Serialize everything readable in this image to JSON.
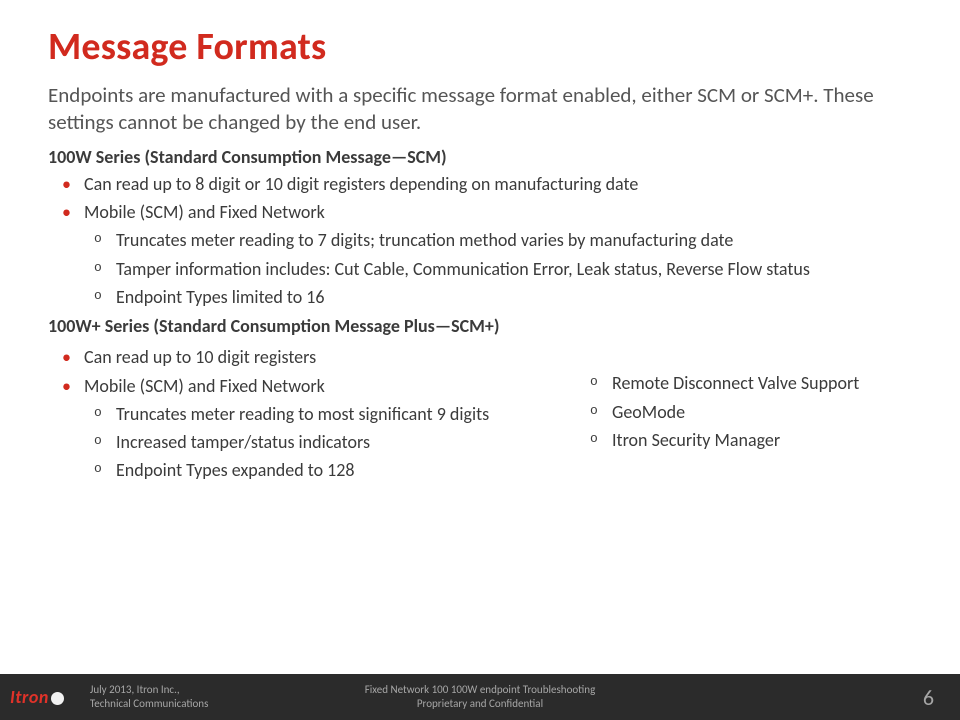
{
  "title": "Message Formats",
  "intro": "Endpoints are manufactured with a specific message format enabled, either SCM or SCM+. These settings cannot be changed by the end user.",
  "section1": {
    "heading": "100W Series  (Standard Consumption Message—SCM)",
    "b1": "Can read up to 8 digit or 10 digit registers depending on manufacturing date",
    "b2": "Mobile (SCM) and Fixed Network",
    "s1": "Truncates meter reading to 7 digits; truncation method varies by manufacturing date",
    "s2": "Tamper information includes: Cut Cable, Communication Error, Leak status, Reverse Flow status",
    "s3": "Endpoint Types limited to 16"
  },
  "section2": {
    "heading": "100W+ Series (Standard Consumption Message Plus—SCM+)",
    "b1": "Can read up to 10 digit registers",
    "b2": "Mobile (SCM) and Fixed Network",
    "s1": "Truncates meter reading to most significant 9 digits",
    "s2": "Increased tamper/status indicators",
    "s3": "Endpoint Types expanded to 128",
    "r1": "Remote Disconnect  Valve Support",
    "r2": "GeoMode",
    "r3": "Itron Security Manager"
  },
  "footer": {
    "logo": "Itron",
    "left1": "July 2013, Itron Inc.,",
    "left2": "Technical Communications",
    "center1": "Fixed Network 100 100W endpoint Troubleshooting",
    "center2": "Proprietary and Confidential",
    "page": "6"
  }
}
